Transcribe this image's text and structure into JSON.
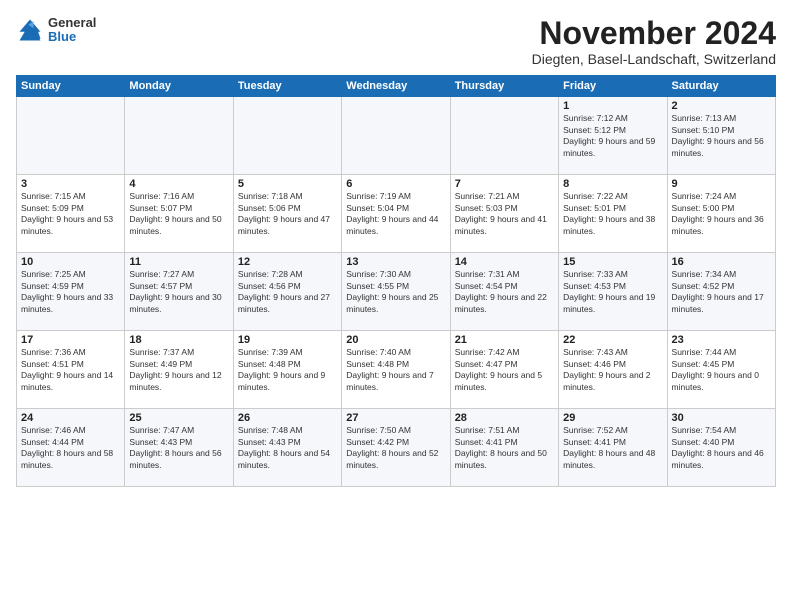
{
  "logo": {
    "general": "General",
    "blue": "Blue"
  },
  "title": "November 2024",
  "location": "Diegten, Basel-Landschaft, Switzerland",
  "headers": [
    "Sunday",
    "Monday",
    "Tuesday",
    "Wednesday",
    "Thursday",
    "Friday",
    "Saturday"
  ],
  "weeks": [
    [
      {
        "day": "",
        "sunrise": "",
        "sunset": "",
        "daylight": ""
      },
      {
        "day": "",
        "sunrise": "",
        "sunset": "",
        "daylight": ""
      },
      {
        "day": "",
        "sunrise": "",
        "sunset": "",
        "daylight": ""
      },
      {
        "day": "",
        "sunrise": "",
        "sunset": "",
        "daylight": ""
      },
      {
        "day": "",
        "sunrise": "",
        "sunset": "",
        "daylight": ""
      },
      {
        "day": "1",
        "sunrise": "Sunrise: 7:12 AM",
        "sunset": "Sunset: 5:12 PM",
        "daylight": "Daylight: 9 hours and 59 minutes."
      },
      {
        "day": "2",
        "sunrise": "Sunrise: 7:13 AM",
        "sunset": "Sunset: 5:10 PM",
        "daylight": "Daylight: 9 hours and 56 minutes."
      }
    ],
    [
      {
        "day": "3",
        "sunrise": "Sunrise: 7:15 AM",
        "sunset": "Sunset: 5:09 PM",
        "daylight": "Daylight: 9 hours and 53 minutes."
      },
      {
        "day": "4",
        "sunrise": "Sunrise: 7:16 AM",
        "sunset": "Sunset: 5:07 PM",
        "daylight": "Daylight: 9 hours and 50 minutes."
      },
      {
        "day": "5",
        "sunrise": "Sunrise: 7:18 AM",
        "sunset": "Sunset: 5:06 PM",
        "daylight": "Daylight: 9 hours and 47 minutes."
      },
      {
        "day": "6",
        "sunrise": "Sunrise: 7:19 AM",
        "sunset": "Sunset: 5:04 PM",
        "daylight": "Daylight: 9 hours and 44 minutes."
      },
      {
        "day": "7",
        "sunrise": "Sunrise: 7:21 AM",
        "sunset": "Sunset: 5:03 PM",
        "daylight": "Daylight: 9 hours and 41 minutes."
      },
      {
        "day": "8",
        "sunrise": "Sunrise: 7:22 AM",
        "sunset": "Sunset: 5:01 PM",
        "daylight": "Daylight: 9 hours and 38 minutes."
      },
      {
        "day": "9",
        "sunrise": "Sunrise: 7:24 AM",
        "sunset": "Sunset: 5:00 PM",
        "daylight": "Daylight: 9 hours and 36 minutes."
      }
    ],
    [
      {
        "day": "10",
        "sunrise": "Sunrise: 7:25 AM",
        "sunset": "Sunset: 4:59 PM",
        "daylight": "Daylight: 9 hours and 33 minutes."
      },
      {
        "day": "11",
        "sunrise": "Sunrise: 7:27 AM",
        "sunset": "Sunset: 4:57 PM",
        "daylight": "Daylight: 9 hours and 30 minutes."
      },
      {
        "day": "12",
        "sunrise": "Sunrise: 7:28 AM",
        "sunset": "Sunset: 4:56 PM",
        "daylight": "Daylight: 9 hours and 27 minutes."
      },
      {
        "day": "13",
        "sunrise": "Sunrise: 7:30 AM",
        "sunset": "Sunset: 4:55 PM",
        "daylight": "Daylight: 9 hours and 25 minutes."
      },
      {
        "day": "14",
        "sunrise": "Sunrise: 7:31 AM",
        "sunset": "Sunset: 4:54 PM",
        "daylight": "Daylight: 9 hours and 22 minutes."
      },
      {
        "day": "15",
        "sunrise": "Sunrise: 7:33 AM",
        "sunset": "Sunset: 4:53 PM",
        "daylight": "Daylight: 9 hours and 19 minutes."
      },
      {
        "day": "16",
        "sunrise": "Sunrise: 7:34 AM",
        "sunset": "Sunset: 4:52 PM",
        "daylight": "Daylight: 9 hours and 17 minutes."
      }
    ],
    [
      {
        "day": "17",
        "sunrise": "Sunrise: 7:36 AM",
        "sunset": "Sunset: 4:51 PM",
        "daylight": "Daylight: 9 hours and 14 minutes."
      },
      {
        "day": "18",
        "sunrise": "Sunrise: 7:37 AM",
        "sunset": "Sunset: 4:49 PM",
        "daylight": "Daylight: 9 hours and 12 minutes."
      },
      {
        "day": "19",
        "sunrise": "Sunrise: 7:39 AM",
        "sunset": "Sunset: 4:48 PM",
        "daylight": "Daylight: 9 hours and 9 minutes."
      },
      {
        "day": "20",
        "sunrise": "Sunrise: 7:40 AM",
        "sunset": "Sunset: 4:48 PM",
        "daylight": "Daylight: 9 hours and 7 minutes."
      },
      {
        "day": "21",
        "sunrise": "Sunrise: 7:42 AM",
        "sunset": "Sunset: 4:47 PM",
        "daylight": "Daylight: 9 hours and 5 minutes."
      },
      {
        "day": "22",
        "sunrise": "Sunrise: 7:43 AM",
        "sunset": "Sunset: 4:46 PM",
        "daylight": "Daylight: 9 hours and 2 minutes."
      },
      {
        "day": "23",
        "sunrise": "Sunrise: 7:44 AM",
        "sunset": "Sunset: 4:45 PM",
        "daylight": "Daylight: 9 hours and 0 minutes."
      }
    ],
    [
      {
        "day": "24",
        "sunrise": "Sunrise: 7:46 AM",
        "sunset": "Sunset: 4:44 PM",
        "daylight": "Daylight: 8 hours and 58 minutes."
      },
      {
        "day": "25",
        "sunrise": "Sunrise: 7:47 AM",
        "sunset": "Sunset: 4:43 PM",
        "daylight": "Daylight: 8 hours and 56 minutes."
      },
      {
        "day": "26",
        "sunrise": "Sunrise: 7:48 AM",
        "sunset": "Sunset: 4:43 PM",
        "daylight": "Daylight: 8 hours and 54 minutes."
      },
      {
        "day": "27",
        "sunrise": "Sunrise: 7:50 AM",
        "sunset": "Sunset: 4:42 PM",
        "daylight": "Daylight: 8 hours and 52 minutes."
      },
      {
        "day": "28",
        "sunrise": "Sunrise: 7:51 AM",
        "sunset": "Sunset: 4:41 PM",
        "daylight": "Daylight: 8 hours and 50 minutes."
      },
      {
        "day": "29",
        "sunrise": "Sunrise: 7:52 AM",
        "sunset": "Sunset: 4:41 PM",
        "daylight": "Daylight: 8 hours and 48 minutes."
      },
      {
        "day": "30",
        "sunrise": "Sunrise: 7:54 AM",
        "sunset": "Sunset: 4:40 PM",
        "daylight": "Daylight: 8 hours and 46 minutes."
      }
    ]
  ]
}
